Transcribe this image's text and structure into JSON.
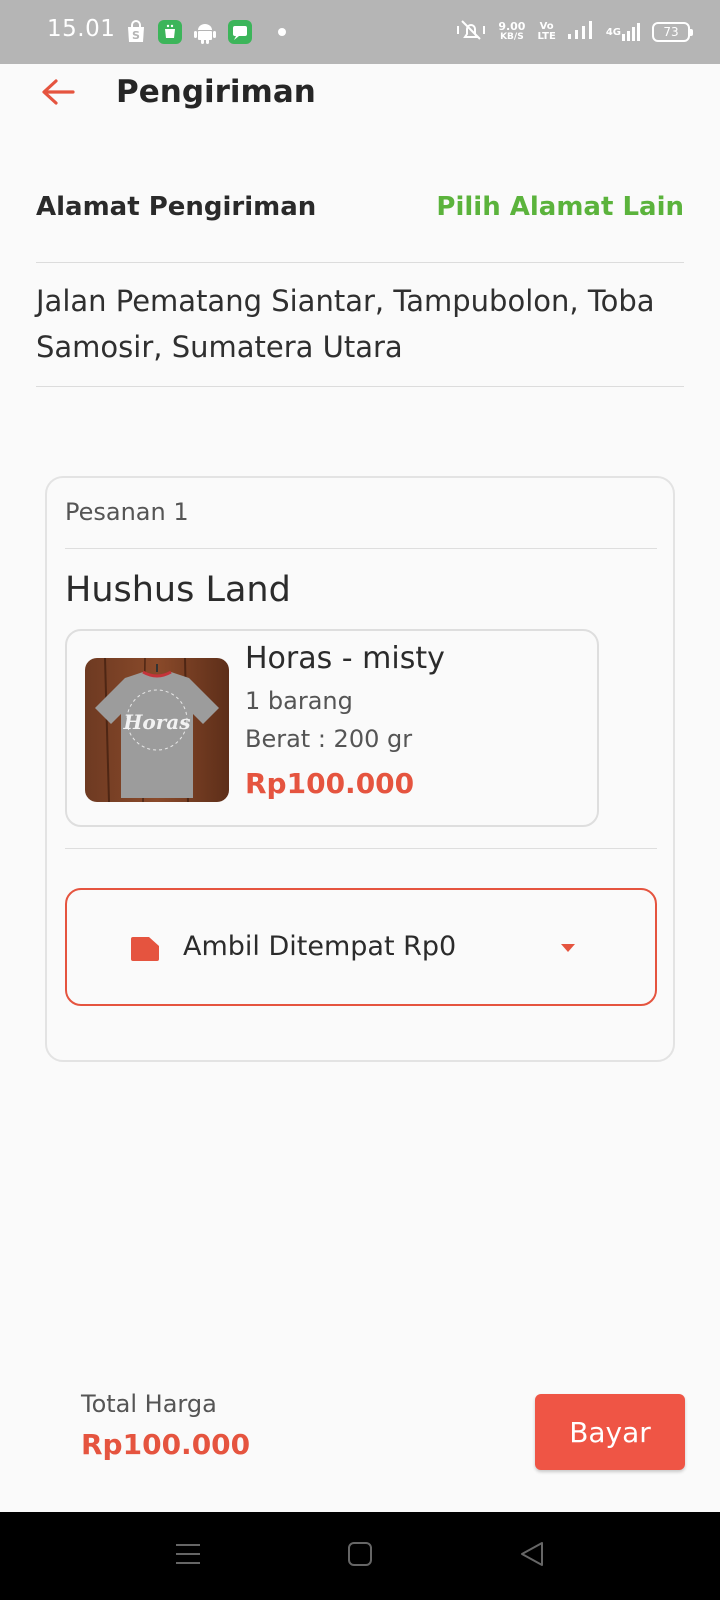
{
  "status_bar": {
    "time": "15.01",
    "net_speed_value": "9.00",
    "net_speed_unit": "KB/S",
    "volte_top": "Vo",
    "volte_bottom": "LTE",
    "network_type": "4G",
    "battery": "73"
  },
  "header": {
    "title": "Pengiriman"
  },
  "address": {
    "title": "Alamat Pengiriman",
    "change_link": "Pilih Alamat Lain",
    "text": "Jalan Pematang Siantar, Tampubolon, Toba Samosir, Sumatera Utara"
  },
  "order": {
    "label": "Pesanan 1",
    "shop_name": "Hushus Land",
    "product": {
      "name": "Horas - misty",
      "quantity": "1 barang",
      "weight": "Berat : 200 gr",
      "price": "Rp100.000",
      "image_text": "Horas"
    },
    "shipping": {
      "label": "Ambil Ditempat Rp0"
    }
  },
  "footer": {
    "total_label": "Total Harga",
    "total_value": "Rp100.000",
    "pay_button": "Bayar"
  },
  "colors": {
    "accent": "#e5543f",
    "link": "#5bb33c",
    "pay_button": "#ef5545"
  }
}
